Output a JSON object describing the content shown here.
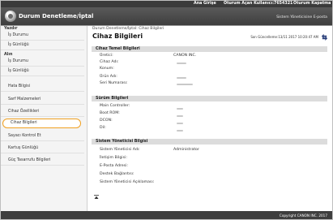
{
  "topbar": {
    "login": "Ana Girişe",
    "user": "Oturum Açan Kullanıcı:",
    "user_id": "7654321",
    "logout": "Oturum Kapatma"
  },
  "header": {
    "title": "Durum Denetleme/İptal",
    "sys_mgr_link": "Sistem Yöneticisine E-posta"
  },
  "sidebar": {
    "groups": [
      {
        "title": "Yazdır",
        "items": [
          "İş Durumu",
          "İş Günlüğü"
        ]
      },
      {
        "title": "Alın",
        "items": [
          "İş Durumu",
          "İş Günlüğü",
          "Hata Bilgisi",
          "Sarf Malzemeleri",
          "Cihaz Özellikleri",
          "Cihaz Bilgileri",
          "Sayacı Kontrol Et",
          "Kartuş Günlüğü",
          "Güç Tasarrufu Bilgileri"
        ]
      }
    ],
    "active_item": "Cihaz Bilgileri"
  },
  "main": {
    "breadcrumb": "Durum Denetleme/İptal: Cihaz Bilgileri",
    "title": "Cihaz Bilgileri",
    "last_updated": "Son Güncelleme:13/11 2017 10:20:47 AM",
    "sections": [
      {
        "title": "Cihaz Temel Bilgileri",
        "rows": [
          {
            "label": "Üretici:",
            "value": "CANON INC."
          },
          {
            "label": "Cihaz Adı:",
            "value": ""
          },
          {
            "label": "Konum:",
            "value": ""
          },
          {
            "label": "Ürün Adı:",
            "value": ""
          },
          {
            "label": "Seri Numarası:",
            "value": ""
          }
        ]
      },
      {
        "title": "Sürüm Bilgileri",
        "rows": [
          {
            "label": "Main Controller:",
            "value": ""
          },
          {
            "label": "Boot ROM:",
            "value": ""
          },
          {
            "label": "DCON:",
            "value": ""
          },
          {
            "label": "Dil:",
            "value": ""
          }
        ]
      },
      {
        "title": "Sistem Yöneticisi Bilgisi",
        "rows": [
          {
            "label": "Sistem Yöneticisi Adı:",
            "value": "Administrator"
          },
          {
            "label": "İletişim Bilgisi:",
            "value": ""
          },
          {
            "label": "E-Posta Adresi:",
            "value": ""
          },
          {
            "label": "Destek Bağlantısı:",
            "value": ""
          },
          {
            "label": "Sistem Yöneticisi Açıklaması:",
            "value": ""
          }
        ]
      }
    ]
  },
  "footer": {
    "copyright": "Copyright CANON INC. 2017"
  }
}
